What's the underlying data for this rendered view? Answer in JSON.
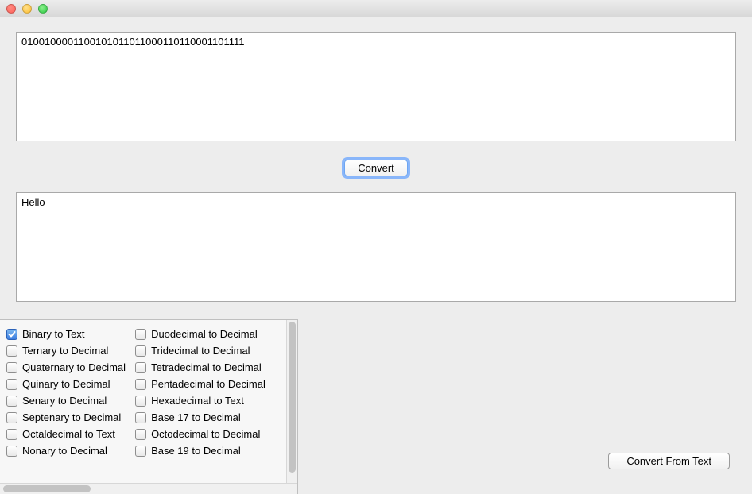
{
  "titlebar": {},
  "input": {
    "value": "0100100001100101011011000110110001101111"
  },
  "buttons": {
    "convert": "Convert",
    "convert_from_text": "Convert From Text"
  },
  "output": {
    "value": "Hello"
  },
  "options": {
    "col1": [
      {
        "label": "Binary to Text",
        "checked": true
      },
      {
        "label": "Ternary to Decimal",
        "checked": false
      },
      {
        "label": "Quaternary to Decimal",
        "checked": false
      },
      {
        "label": "Quinary to Decimal",
        "checked": false
      },
      {
        "label": "Senary to Decimal",
        "checked": false
      },
      {
        "label": "Septenary to Decimal",
        "checked": false
      },
      {
        "label": "Octaldecimal to Text",
        "checked": false
      },
      {
        "label": "Nonary to Decimal",
        "checked": false
      }
    ],
    "col2": [
      {
        "label": "Duodecimal to Decimal",
        "checked": false
      },
      {
        "label": "Tridecimal to Decimal",
        "checked": false
      },
      {
        "label": "Tetradecimal to Decimal",
        "checked": false
      },
      {
        "label": "Pentadecimal to Decimal",
        "checked": false
      },
      {
        "label": "Hexadecimal to Text",
        "checked": false
      },
      {
        "label": "Base 17 to Decimal",
        "checked": false
      },
      {
        "label": "Octodecimal to Decimal",
        "checked": false
      },
      {
        "label": "Base 19 to Decimal",
        "checked": false
      }
    ]
  }
}
